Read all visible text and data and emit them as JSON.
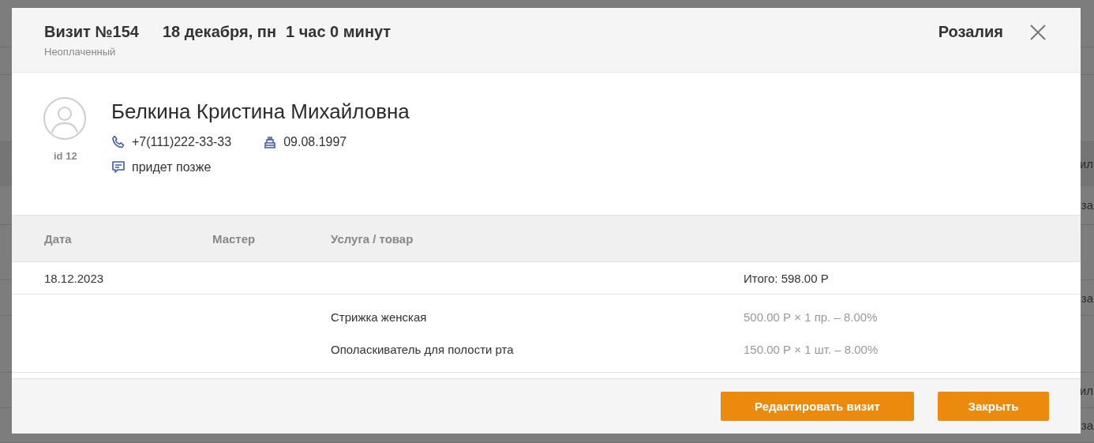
{
  "background": {
    "right_fragments": [
      "ил",
      "за",
      "за",
      "ил",
      "за"
    ]
  },
  "visit": {
    "title": "Визит №154",
    "date": "18 декабря, пн",
    "duration": "1 час 0 минут",
    "status": "Неоплаченный",
    "master": "Розалия"
  },
  "client": {
    "name": "Белкина Кристина Михайловна",
    "id": "id 12",
    "phone": "+7(111)222-33-33",
    "birthday": "09.08.1997",
    "comment": "придет позже"
  },
  "table": {
    "columns": [
      "Дата",
      "Мастер",
      "Услуга / товар"
    ],
    "date_row": {
      "date": "18.12.2023",
      "total": "Итого: 598.00 Р"
    },
    "items": [
      {
        "name": "Стрижка женская",
        "price": "500.00 Р × 1 пр. – 8.00%"
      },
      {
        "name": "Ополаскиватель для полости рта",
        "price": "150.00 Р × 1 шт. – 8.00%"
      }
    ]
  },
  "buttons": [
    {
      "label": "Редактировать визит"
    },
    {
      "label": "Закрыть"
    }
  ]
}
